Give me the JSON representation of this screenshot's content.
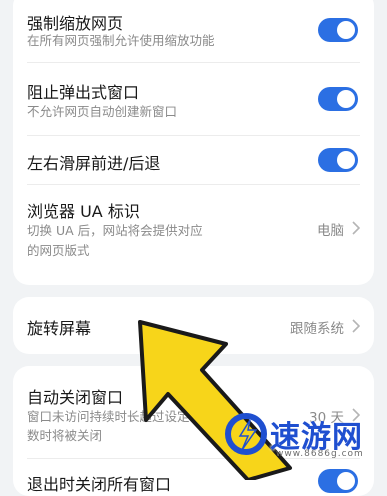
{
  "section1": {
    "items": [
      {
        "title": "强制缩放网页",
        "subtitle": "在所有网页强制允许使用缩放功能",
        "toggle": true
      },
      {
        "title": "阻止弹出式窗口",
        "subtitle": "不允许网页自动创建新窗口",
        "toggle": true
      },
      {
        "title": "左右滑屏前进/后退",
        "toggle": true
      },
      {
        "title": "浏览器 UA 标识",
        "subtitle_lines": [
          "切换 UA 后，网站将会提供对应",
          "的网页版式"
        ],
        "value": "电脑"
      }
    ]
  },
  "section2": {
    "title": "旋转屏幕",
    "value": "跟随系统"
  },
  "section3": {
    "items": [
      {
        "title": "自动关闭窗口",
        "subtitle_lines": [
          "窗口未访问持续时长超过设定",
          "数时将被关闭"
        ],
        "value": "30 天"
      },
      {
        "title": "退出时关闭所有窗口",
        "toggle": true
      }
    ]
  },
  "colors": {
    "accent": "#2b6fe3",
    "arrow": "#f7d51a"
  },
  "watermark": {
    "text": "速游网",
    "url": "www.8686g.com",
    "icon": "speed-logo-icon"
  }
}
